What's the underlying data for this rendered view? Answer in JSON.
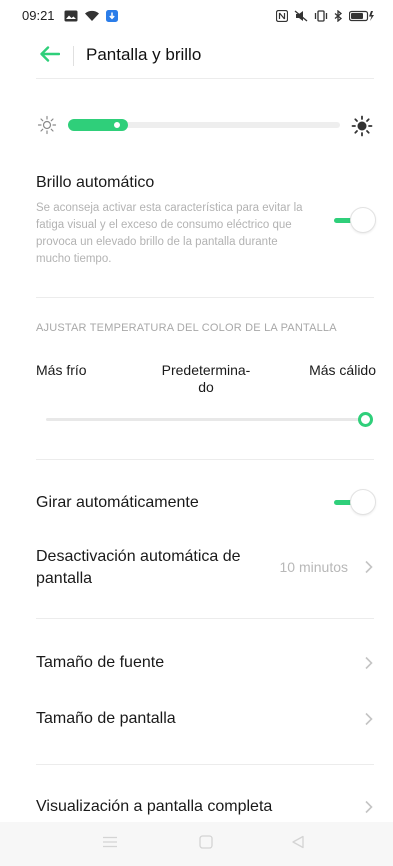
{
  "status_bar": {
    "time": "09:21",
    "left_icons": [
      "image-icon",
      "wifi-icon",
      "app-notification-icon"
    ],
    "right_icons": [
      "nfc-icon",
      "mute-icon",
      "vibrate-icon",
      "bluetooth-icon",
      "battery-icon"
    ]
  },
  "header": {
    "title": "Pantalla y brillo",
    "back_icon": "arrow-left-icon",
    "accent": "#2fcf7a"
  },
  "brightness": {
    "level": 0.22,
    "low_icon": "sun-outline-icon",
    "high_icon": "sun-filled-icon"
  },
  "auto_brightness": {
    "title": "Brillo automático",
    "description": "Se aconseja activar esta característica para evitar la fatiga visual y el exceso de consumo eléctrico que provoca un elevado brillo de la pantalla durante mucho tiempo.",
    "enabled": true
  },
  "color_temperature": {
    "section_title": "AJUSTAR TEMPERATURA DEL COLOR DE LA PANTALLA",
    "cold_label": "Más frío",
    "default_label": "Predetermina-\ndo",
    "warm_label": "Más cálido",
    "level": 1.0
  },
  "rows": {
    "auto_rotate": {
      "label": "Girar automáticamente",
      "enabled": true
    },
    "screen_timeout": {
      "label": "Desactivación automática de pantalla",
      "value": "10 minutos"
    },
    "font_size": {
      "label": "Tamaño de fuente"
    },
    "display_size": {
      "label": "Tamaño de pantalla"
    },
    "fullscreen": {
      "label": "Visualización a pantalla completa"
    }
  },
  "nav_bar": {
    "icons": [
      "menu-icon",
      "home-icon",
      "back-icon"
    ]
  }
}
